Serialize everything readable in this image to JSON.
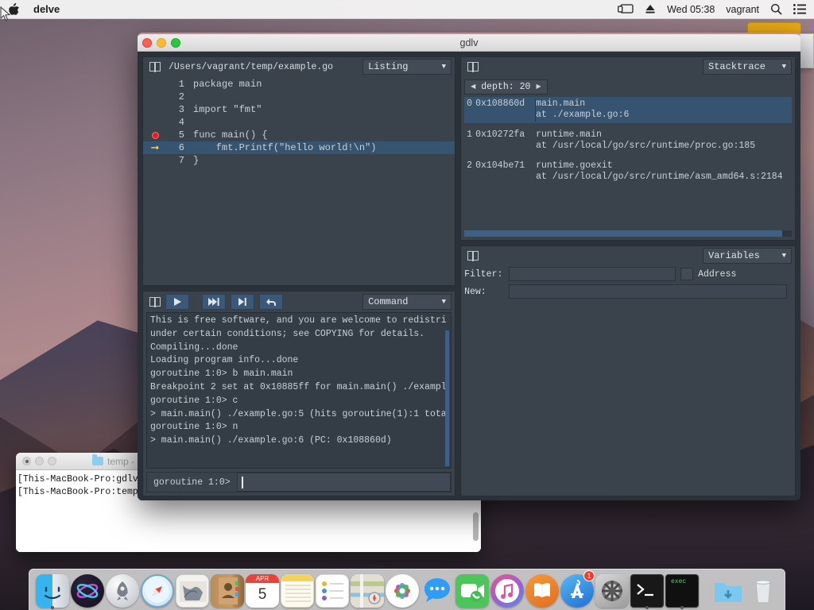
{
  "menubar": {
    "apple_icon": "apple-logo",
    "app_name": "delve",
    "right_items": [
      {
        "icon": "airplay-icon",
        "label": ""
      },
      {
        "icon": "eject-icon",
        "label": ""
      },
      {
        "icon": "clock",
        "label": "Wed 05:38"
      },
      {
        "icon": "user",
        "label": "vagrant"
      },
      {
        "icon": "search-icon",
        "label": ""
      },
      {
        "icon": "control-center-icon",
        "label": ""
      }
    ]
  },
  "gdlv": {
    "window_title": "gdlv",
    "listing": {
      "file_path": "/Users/vagrant/temp/example.go",
      "dropdown_label": "Listing",
      "lines": [
        {
          "num": "1",
          "text": "package main",
          "mark": "",
          "current": false
        },
        {
          "num": "2",
          "text": "",
          "mark": "",
          "current": false
        },
        {
          "num": "3",
          "text": "import \"fmt\"",
          "mark": "",
          "current": false
        },
        {
          "num": "4",
          "text": "",
          "mark": "",
          "current": false
        },
        {
          "num": "5",
          "text": "func main() {",
          "mark": "breakpoint",
          "current": false
        },
        {
          "num": "6",
          "text": "    fmt.Printf(\"hello world!\\n\")",
          "mark": "pc-arrow",
          "current": true
        },
        {
          "num": "7",
          "text": "}",
          "mark": "",
          "current": false
        }
      ]
    },
    "command": {
      "dropdown_label": "Command",
      "buttons": [
        {
          "name": "split-panel-icon",
          "label": ""
        },
        {
          "name": "continue-button",
          "label": "▶"
        },
        {
          "name": "step-over-button",
          "label": "⏭"
        },
        {
          "name": "step-into-button",
          "label": "⏯"
        },
        {
          "name": "step-out-button",
          "label": "↩"
        }
      ],
      "output_lines": [
        "This is free software, and you are welcome to redistri",
        "under certain conditions; see COPYING for details.",
        "Compiling...done",
        "Loading program info...done",
        "goroutine 1:0> b main.main",
        "Breakpoint 2 set at 0x10885ff for main.main() ./exampl",
        "goroutine 1:0> c",
        "> main.main() ./example.go:5 (hits goroutine(1):1 tota",
        "goroutine 1:0> n",
        "> main.main() ./example.go:6 (PC: 0x108860d)"
      ],
      "prompt": "goroutine 1:0>",
      "input_value": ""
    },
    "stacktrace": {
      "dropdown_label": "Stacktrace",
      "depth_label": "depth:",
      "depth_value": "20",
      "frames": [
        {
          "index": "0",
          "address": "0x108860d",
          "func": "main.main",
          "location": "at ./example.go:6",
          "selected": true
        },
        {
          "index": "1",
          "address": "0x10272fa",
          "func": "runtime.main",
          "location": "at /usr/local/go/src/runtime/proc.go:185",
          "selected": false
        },
        {
          "index": "2",
          "address": "0x104be71",
          "func": "runtime.goexit",
          "location": "at /usr/local/go/src/runtime/asm_amd64.s:2184",
          "selected": false
        }
      ]
    },
    "variables": {
      "dropdown_label": "Variables",
      "filter_label": "Filter:",
      "filter_value": "",
      "address_label": "Address",
      "address_checked": false,
      "new_label": "New:",
      "new_value": ""
    }
  },
  "terminal": {
    "title": "temp -",
    "lines": [
      "[This-MacBook-Pro:gdlv",
      "[This-MacBook-Pro:temp"
    ]
  },
  "dock": {
    "items": [
      {
        "name": "finder",
        "running": true
      },
      {
        "name": "siri",
        "running": false
      },
      {
        "name": "launchpad",
        "running": false
      },
      {
        "name": "safari",
        "running": false
      },
      {
        "name": "mail",
        "running": false
      },
      {
        "name": "contacts",
        "running": false
      },
      {
        "name": "calendar",
        "running": false,
        "month": "APR",
        "day": "5"
      },
      {
        "name": "notes",
        "running": false
      },
      {
        "name": "reminders",
        "running": false
      },
      {
        "name": "maps",
        "running": false
      },
      {
        "name": "photos",
        "running": false
      },
      {
        "name": "messages",
        "running": false
      },
      {
        "name": "facetime",
        "running": false
      },
      {
        "name": "itunes",
        "running": false
      },
      {
        "name": "ibooks",
        "running": false
      },
      {
        "name": "app-store",
        "running": false,
        "badge": "1"
      },
      {
        "name": "system-preferences",
        "running": false
      },
      {
        "name": "terminal",
        "running": true
      },
      {
        "name": "exec-terminal",
        "running": true,
        "label": "exec"
      },
      {
        "name": "downloads-folder",
        "running": false
      },
      {
        "name": "trash",
        "running": false
      }
    ]
  },
  "colors": {
    "panel_bg": "#3a424b",
    "window_bg": "#2b3139",
    "highlight": "#36536f",
    "text": "#c9d1d8",
    "button_blue": "#3c5877",
    "breakpoint_red": "#e02020",
    "pc_arrow_yellow": "#ffd93b"
  }
}
